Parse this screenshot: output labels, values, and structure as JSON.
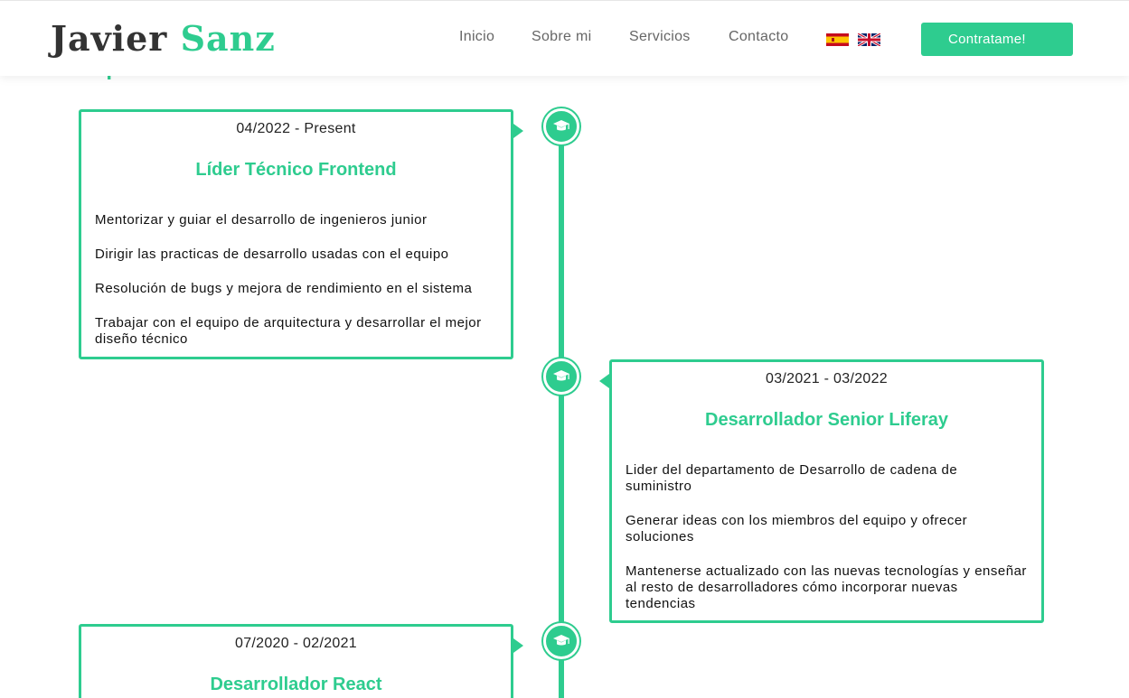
{
  "header": {
    "logo_first": "Javier",
    "logo_last": "Sanz",
    "nav": [
      "Inicio",
      "Sobre mi",
      "Servicios",
      "Contacto"
    ],
    "cta_label": "Contratame!"
  },
  "section_title_partial": "Experiencia",
  "timeline": [
    {
      "date": "04/2022 - Present",
      "role": "Líder Técnico Frontend",
      "tasks": [
        "Mentorizar y guiar el desarrollo de ingenieros junior",
        "Dirigir las practicas de desarrollo usadas con el equipo",
        "Resolución de bugs y mejora de rendimiento en el sistema",
        "Trabajar con el equipo de arquitectura y desarrollar el mejor diseño técnico"
      ]
    },
    {
      "date": "03/2021 - 03/2022",
      "role": "Desarrollador Senior Liferay",
      "tasks": [
        "Lider del departamento de Desarrollo de cadena de suministro",
        "Generar ideas con los miembros del equipo y ofrecer soluciones",
        "Mantenerse actualizado con las nuevas tecnologías y enseñar al resto de desarrolladores cómo incorporar nuevas tendencias"
      ]
    },
    {
      "date": "07/2020 - 02/2021",
      "role": "Desarrollador React",
      "tasks": []
    }
  ],
  "colors": {
    "accent": "#2ecc8f",
    "text": "#222222",
    "nav_text": "#666666"
  },
  "icons": {
    "timeline_node": "graduation-cap-icon",
    "flag_es": "spain-flag-icon",
    "flag_en": "uk-flag-icon"
  }
}
